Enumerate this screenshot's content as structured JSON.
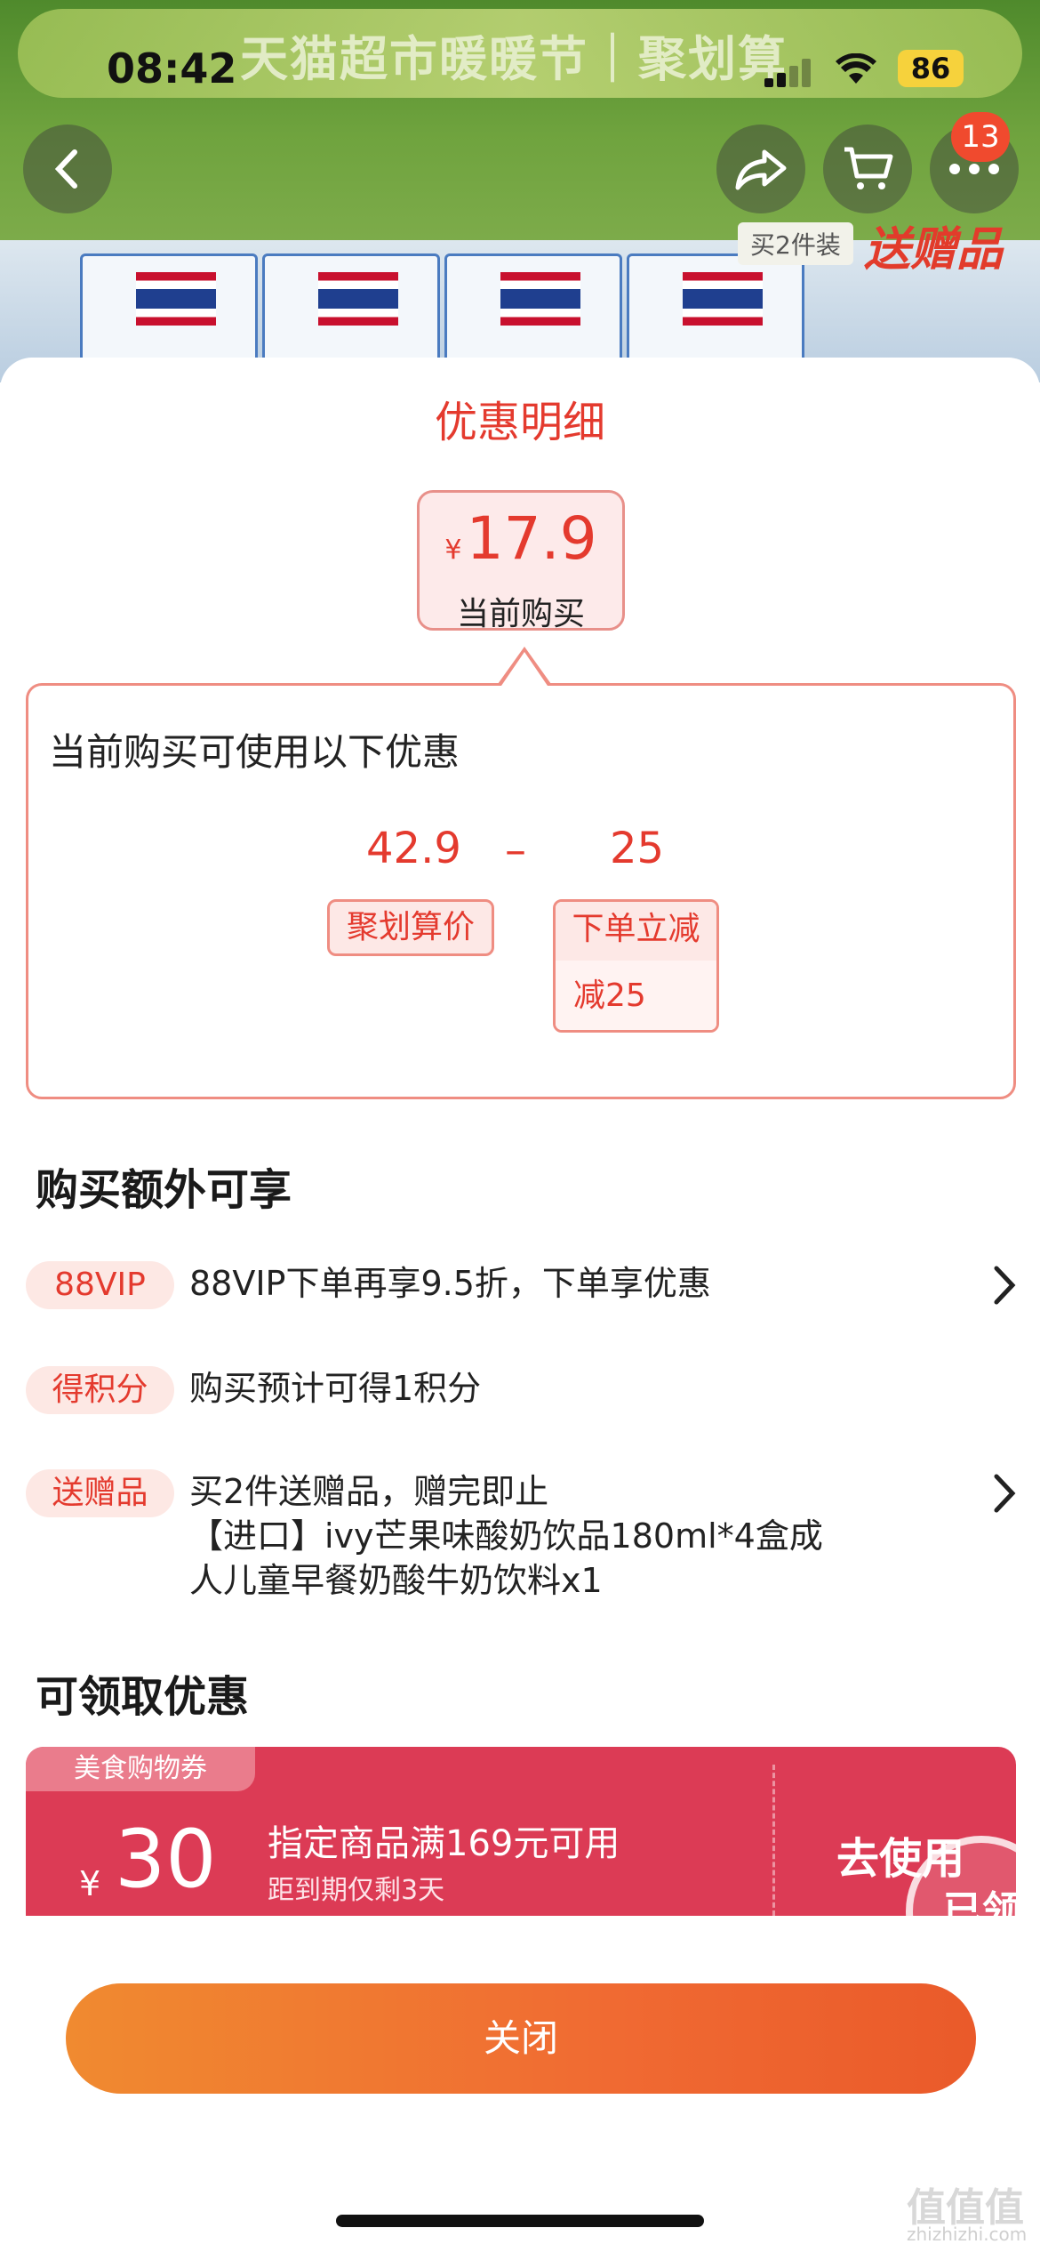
{
  "status_bar": {
    "time": "08:42",
    "battery": "86"
  },
  "backdrop": {
    "banner_text": "天猫超市暖暖节｜聚划算",
    "product_tag": "买2件装",
    "gift_tag": "送赠品",
    "cart_badge": "13"
  },
  "sheet": {
    "title": "优惠明细",
    "price_card": {
      "currency": "¥",
      "price": "17.9",
      "label": "当前购买"
    },
    "detail": {
      "heading": "当前购买可使用以下优惠",
      "base_price": "42.9",
      "operator": "–",
      "discount": "25",
      "base_label": "聚划算价",
      "discount_label": "下单立减",
      "discount_desc": "减25"
    },
    "extras_title": "购买额外可享",
    "benefits": [
      {
        "tag": "88VIP",
        "text": "88VIP下单再享9.5折，下单享优惠",
        "has_arrow": true
      },
      {
        "tag": "得积分",
        "text": "购买预计可得1积分",
        "has_arrow": false
      },
      {
        "tag": "送赠品",
        "text_lines": [
          "买2件送赠品，赠完即止",
          "【进口】ivy芒果味酸奶饮品180ml*4盒成",
          "人儿童早餐奶酸牛奶饮料x1"
        ],
        "has_arrow": true
      }
    ],
    "coupons_title": "可领取优惠",
    "coupon": {
      "tag": "美食购物券",
      "currency": "¥",
      "amount": "30",
      "condition": "指定商品满169元可用",
      "expiry": "距到期仅剩3天",
      "action": "去使用",
      "stamp": "已领"
    },
    "close_label": "关闭"
  },
  "watermark": {
    "text": "值值值",
    "sub": "zhizhizhi.com"
  },
  "colors": {
    "accent": "#e43a2e",
    "coupon": "#dc3b55",
    "button_start": "#f08a30",
    "button_end": "#ea5a2a"
  }
}
